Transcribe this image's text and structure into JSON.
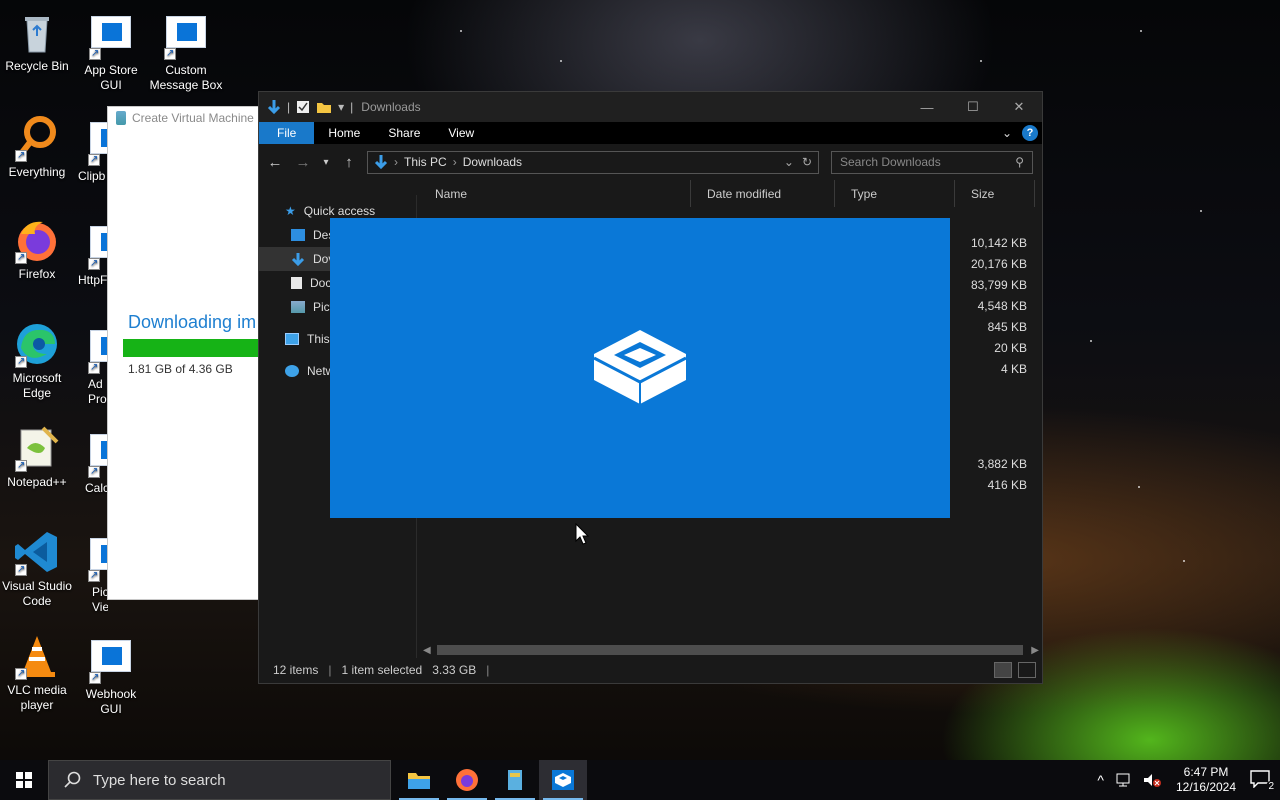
{
  "desktop": {
    "icons": [
      {
        "label": "Recycle Bin"
      },
      {
        "label": "App Store GUI"
      },
      {
        "label": "Custom Message Box"
      },
      {
        "label": "Everything"
      },
      {
        "label": "Clipb"
      },
      {
        "label": "Firefox"
      },
      {
        "label": "HttpF"
      },
      {
        "label": "Microsoft Edge"
      },
      {
        "label": "Ad Pro"
      },
      {
        "label": "Notepad++"
      },
      {
        "label": "Calc"
      },
      {
        "label": "Visual Studio Code"
      },
      {
        "label": "Pic Viewer"
      },
      {
        "label": "VLC media player"
      },
      {
        "label": "Webhook GUI"
      }
    ]
  },
  "vm_window": {
    "title": "Create Virtual Machine",
    "status": "Downloading im",
    "progress_fraction": 0.415,
    "progress_text": "1.81 GB of 4.36 GB"
  },
  "explorer": {
    "title": "Downloads",
    "ribbon_tabs": [
      "File",
      "Home",
      "Share",
      "View"
    ],
    "breadcrumb": [
      "This PC",
      "Downloads"
    ],
    "search_placeholder": "Search Downloads",
    "nav_items": [
      {
        "label": "Quick access",
        "icon": "star-icon"
      },
      {
        "label": "Des",
        "icon": "desktop-folder-icon"
      },
      {
        "label": "Dov",
        "icon": "download-arrow-icon"
      },
      {
        "label": "Doc",
        "icon": "document-icon"
      },
      {
        "label": "Pict",
        "icon": "pictures-icon"
      },
      {
        "label": "This P",
        "icon": "computer-icon"
      },
      {
        "label": "Netw",
        "icon": "network-icon"
      }
    ],
    "columns": [
      "Name",
      "Date modified",
      "Type",
      "Size"
    ],
    "sizes": [
      "10,142 KB",
      "20,176 KB",
      "83,799 KB",
      "4,548 KB",
      "845 KB",
      "20 KB",
      "4 KB",
      "3,882 KB",
      "416 KB"
    ],
    "status": {
      "items": "12 items",
      "selected": "1 item selected",
      "selected_size": "3.33 GB"
    }
  },
  "taskbar": {
    "search_placeholder": "Type here to search",
    "time": "6:47 PM",
    "date": "12/16/2024",
    "notification_count": "2"
  },
  "colors": {
    "accent": "#1979ca",
    "splash": "#0a78d7",
    "progress": "#16b316"
  }
}
